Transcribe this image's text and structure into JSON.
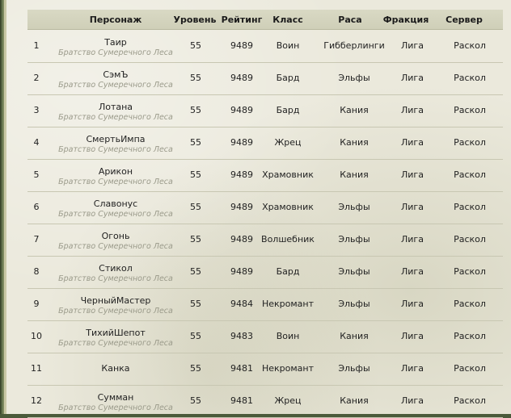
{
  "table": {
    "headers": {
      "character": "Персонаж",
      "level": "Уровень",
      "rating": "Рейтинг",
      "class": "Класс",
      "race": "Раса",
      "faction": "Фракция",
      "server": "Сервер"
    },
    "rows": [
      {
        "rank": "1",
        "name": "Таир",
        "guild": "Братство Сумеречного Леса",
        "level": "55",
        "rating": "9489",
        "class": "Воин",
        "race": "Гибберлинги",
        "faction": "Лига",
        "server": "Раскол"
      },
      {
        "rank": "2",
        "name": "СэмЪ",
        "guild": "Братство Сумеречного Леса",
        "level": "55",
        "rating": "9489",
        "class": "Бард",
        "race": "Эльфы",
        "faction": "Лига",
        "server": "Раскол"
      },
      {
        "rank": "3",
        "name": "Лотана",
        "guild": "Братство Сумеречного Леса",
        "level": "55",
        "rating": "9489",
        "class": "Бард",
        "race": "Кания",
        "faction": "Лига",
        "server": "Раскол"
      },
      {
        "rank": "4",
        "name": "СмертьИмпа",
        "guild": "Братство Сумеречного Леса",
        "level": "55",
        "rating": "9489",
        "class": "Жрец",
        "race": "Кания",
        "faction": "Лига",
        "server": "Раскол"
      },
      {
        "rank": "5",
        "name": "Арикон",
        "guild": "Братство Сумеречного Леса",
        "level": "55",
        "rating": "9489",
        "class": "Храмовник",
        "race": "Кания",
        "faction": "Лига",
        "server": "Раскол"
      },
      {
        "rank": "6",
        "name": "Славонус",
        "guild": "Братство Сумеречного Леса",
        "level": "55",
        "rating": "9489",
        "class": "Храмовник",
        "race": "Эльфы",
        "faction": "Лига",
        "server": "Раскол"
      },
      {
        "rank": "7",
        "name": "Огонь",
        "guild": "Братство Сумеречного Леса",
        "level": "55",
        "rating": "9489",
        "class": "Волшебник",
        "race": "Эльфы",
        "faction": "Лига",
        "server": "Раскол"
      },
      {
        "rank": "8",
        "name": "Стикол",
        "guild": "Братство Сумеречного Леса",
        "level": "55",
        "rating": "9489",
        "class": "Бард",
        "race": "Эльфы",
        "faction": "Лига",
        "server": "Раскол"
      },
      {
        "rank": "9",
        "name": "ЧерныйМастер",
        "guild": "Братство Сумеречного Леса",
        "level": "55",
        "rating": "9484",
        "class": "Некромант",
        "race": "Эльфы",
        "faction": "Лига",
        "server": "Раскол"
      },
      {
        "rank": "10",
        "name": "ТихийШепот",
        "guild": "Братство Сумеречного Леса",
        "level": "55",
        "rating": "9483",
        "class": "Воин",
        "race": "Кания",
        "faction": "Лига",
        "server": "Раскол"
      },
      {
        "rank": "11",
        "name": "Канка",
        "guild": "",
        "level": "55",
        "rating": "9481",
        "class": "Некромант",
        "race": "Эльфы",
        "faction": "Лига",
        "server": "Раскол"
      },
      {
        "rank": "12",
        "name": "Сумман",
        "guild": "Братство Сумеречного Леса",
        "level": "55",
        "rating": "9481",
        "class": "Жрец",
        "race": "Кания",
        "faction": "Лига",
        "server": "Раскол"
      }
    ]
  }
}
